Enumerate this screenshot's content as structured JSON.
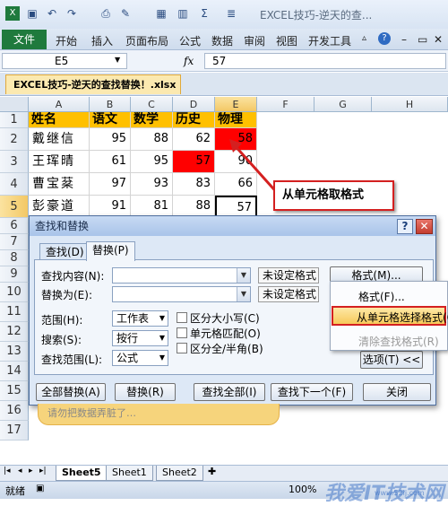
{
  "window": {
    "title": "EXCEL技巧-逆天的查..."
  },
  "ribbon": {
    "file": "文件",
    "tabs": [
      "开始",
      "插入",
      "页面布局",
      "公式",
      "数据",
      "审阅",
      "视图",
      "开发工具"
    ]
  },
  "formula_bar": {
    "name_box": "E5",
    "fx": "fx",
    "value": "57"
  },
  "document": {
    "tab": "EXCEL技巧-逆天的查找替换！.xlsx"
  },
  "sheet": {
    "columns": [
      "A",
      "B",
      "C",
      "D",
      "E",
      "F",
      "G",
      "H"
    ],
    "rows": [
      "1",
      "2",
      "3",
      "4",
      "5",
      "6",
      "7",
      "8",
      "9",
      "10",
      "11",
      "12",
      "13",
      "14",
      "15",
      "16",
      "17"
    ],
    "headers": [
      "姓名",
      "语文",
      "数学",
      "历史",
      "物理"
    ],
    "data": [
      [
        "戴继信",
        "95",
        "88",
        "62",
        "58"
      ],
      [
        "王珲晴",
        "61",
        "95",
        "57",
        "90"
      ],
      [
        "曹宝棻",
        "97",
        "93",
        "83",
        "66"
      ],
      [
        "彭豪道",
        "91",
        "81",
        "88",
        "57"
      ]
    ],
    "red_fill": "#ff0000",
    "header_fill": "#ffc000"
  },
  "callout": {
    "text": "从单元格取格式"
  },
  "dialog": {
    "title": "查找和替换",
    "tabs": [
      "查找(D)",
      "替换(P)"
    ],
    "find_label": "查找内容(N):",
    "replace_label": "替换为(E):",
    "find_format_status": "未设定格式",
    "replace_format_status": "未设定格式",
    "format_button": "格式(M)...",
    "within_label": "范围(H):",
    "within_value": "工作表",
    "search_label": "搜索(S):",
    "search_value": "按行",
    "lookin_label": "查找范围(L):",
    "lookin_value": "公式",
    "match_case": "区分大小写(C)",
    "match_entire": "单元格匹配(O)",
    "match_byte": "区分全/半角(B)",
    "options_button": "选项(T) <<",
    "replace_all": "全部替换(A)",
    "replace": "替换(R)",
    "find_all": "查找全部(I)",
    "find_next": "查找下一个(F)",
    "close": "关闭"
  },
  "format_menu": {
    "items": [
      "格式(F)...",
      "从单元格选择格式(C)...",
      "清除查找格式(R)"
    ]
  },
  "banner": {
    "text": "请勿把数据弄脏了…"
  },
  "sheet_tabs": [
    "Sheet5",
    "Sheet1",
    "Sheet2"
  ],
  "status": {
    "ready": "就绪",
    "zoom": "100%",
    "watermark": "我爱IT技术网",
    "watermark_url": "www.52ij.com"
  }
}
